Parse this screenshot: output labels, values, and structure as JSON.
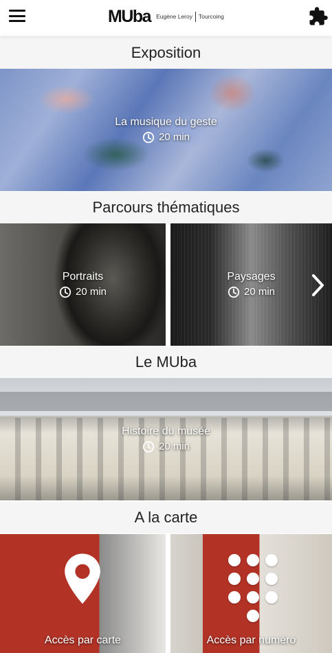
{
  "header": {
    "logo": "MUba",
    "logo_sub_left": "Eugène Leroy",
    "logo_sub_right": "Tourcoing",
    "menu_icon": "hamburger-menu-icon",
    "extension_icon": "puzzle-icon"
  },
  "sections": {
    "exposition": {
      "title": "Exposition",
      "items": [
        {
          "label": "La musique du geste",
          "duration": "20 min"
        }
      ]
    },
    "parcours": {
      "title": "Parcours thématiques",
      "items": [
        {
          "label": "Portraits",
          "duration": "20 min"
        },
        {
          "label": "Paysages",
          "duration": "20 min"
        }
      ],
      "next_icon": "chevron-right-icon"
    },
    "muba": {
      "title": "Le MUba",
      "items": [
        {
          "label": "Histoire du musée",
          "duration": "20 min"
        }
      ]
    },
    "carte": {
      "title": "A la carte",
      "items": [
        {
          "label": "Accès par carte",
          "icon": "map-pin-icon"
        },
        {
          "label": "Accès par numéro",
          "icon": "keypad-icon"
        }
      ]
    }
  },
  "colors": {
    "section_bg": "#f5f5f5",
    "overlay_text": "#ffffff",
    "accent_red": "#b33226"
  }
}
